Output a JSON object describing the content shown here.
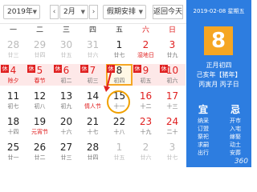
{
  "toolbar": {
    "year_value": "2019年",
    "month_value": "2月",
    "holiday_value": "假期安排",
    "today_label": "返回今天",
    "prev_label": "‹",
    "next_label": "›"
  },
  "weekdays": [
    "一",
    "二",
    "三",
    "四",
    "五",
    "六",
    "日"
  ],
  "weeks": [
    [
      {
        "day": "28",
        "lunar": "廿三",
        "other": true
      },
      {
        "day": "29",
        "lunar": "廿四",
        "other": true
      },
      {
        "day": "30",
        "lunar": "廿五",
        "other": true
      },
      {
        "day": "31",
        "lunar": "廿六",
        "other": true
      },
      {
        "day": "1",
        "lunar": "廿七"
      },
      {
        "day": "2",
        "lunar": "湿地日",
        "weekend": true,
        "red_lunar": true
      },
      {
        "day": "3",
        "lunar": "廿九",
        "weekend": true
      }
    ],
    [
      {
        "day": "4",
        "lunar": "除夕",
        "tag": "休",
        "hol": true,
        "red_lunar": true
      },
      {
        "day": "5",
        "lunar": "春节",
        "tag": "休",
        "hol": true,
        "red_lunar": true
      },
      {
        "day": "6",
        "lunar": "初二",
        "tag": "休",
        "hol": true
      },
      {
        "day": "7",
        "lunar": "初三",
        "tag": "休",
        "hol": true
      },
      {
        "day": "8",
        "lunar": "初四",
        "tag": "休",
        "hol": true,
        "selected": true
      },
      {
        "day": "9",
        "lunar": "初五",
        "tag": "休",
        "hol": true,
        "weekend": true
      },
      {
        "day": "10",
        "lunar": "初六",
        "tag": "休",
        "hol": true,
        "weekend": true
      }
    ],
    [
      {
        "day": "11",
        "lunar": "初七"
      },
      {
        "day": "12",
        "lunar": "初八"
      },
      {
        "day": "13",
        "lunar": "初九"
      },
      {
        "day": "14",
        "lunar": "情人节",
        "red_lunar": true
      },
      {
        "day": "15",
        "lunar": "十一"
      },
      {
        "day": "16",
        "lunar": "十二",
        "weekend": true
      },
      {
        "day": "17",
        "lunar": "十三",
        "weekend": true
      }
    ],
    [
      {
        "day": "18",
        "lunar": "十四"
      },
      {
        "day": "19",
        "lunar": "元宵节",
        "red_lunar": true
      },
      {
        "day": "20",
        "lunar": "十六"
      },
      {
        "day": "21",
        "lunar": "十七"
      },
      {
        "day": "22",
        "lunar": "十八"
      },
      {
        "day": "23",
        "lunar": "十九",
        "weekend": true
      },
      {
        "day": "24",
        "lunar": "二十",
        "weekend": true
      }
    ],
    [
      {
        "day": "25",
        "lunar": "廿一"
      },
      {
        "day": "26",
        "lunar": "廿二"
      },
      {
        "day": "27",
        "lunar": "廿三"
      },
      {
        "day": "28",
        "lunar": "廿四"
      },
      {
        "day": "1",
        "lunar": "廿五",
        "other": true
      },
      {
        "day": "2",
        "lunar": "廿六",
        "other": true
      },
      {
        "day": "3",
        "lunar": "廿七",
        "other": true
      }
    ]
  ],
  "side": {
    "date": "2019-02-08 星期五",
    "big_day": "8",
    "lunar_date": "正月初四",
    "ganzhi_year": "己亥年【猪年】",
    "ganzhi_month_day": "丙寅月 丙子日",
    "yi_label": "宜",
    "ji_label": "忌",
    "yi_items": [
      "纳采",
      "订盟",
      "祭祀",
      "求嗣",
      "出行"
    ],
    "ji_items": [
      "开市",
      "入宅",
      "嫁娶",
      "动土",
      "安葬"
    ],
    "watermark": "360"
  },
  "colors": {
    "accent": "#2d7de0",
    "highlight": "#f5a623",
    "holiday": "#e02020"
  }
}
